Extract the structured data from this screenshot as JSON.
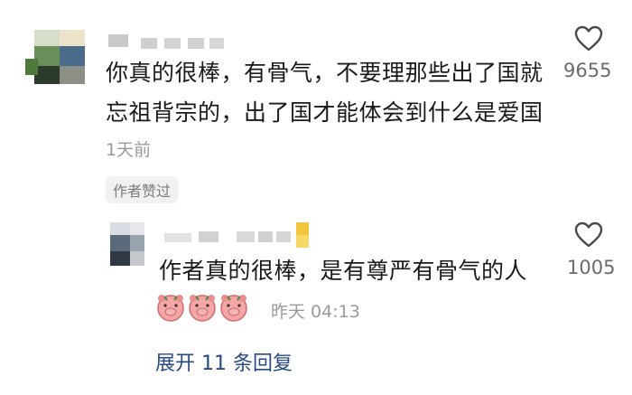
{
  "comments": [
    {
      "text_line1": "你真的很棒，有骨气，不要理那些出了国就",
      "text_line2": "忘祖背宗的，出了国才能体会到什么是爱国",
      "time": "1天前",
      "badge": "作者赞过",
      "likes": "9655"
    }
  ],
  "reply": {
    "text": "作者真的很棒，是有尊严有骨气的人",
    "time": "昨天 04:13",
    "likes": "1005",
    "emoji_count": 3
  },
  "expand_label": "展开 11 条回复",
  "colors": {
    "accent_link": "#274a85",
    "muted": "#9a9a9a"
  }
}
